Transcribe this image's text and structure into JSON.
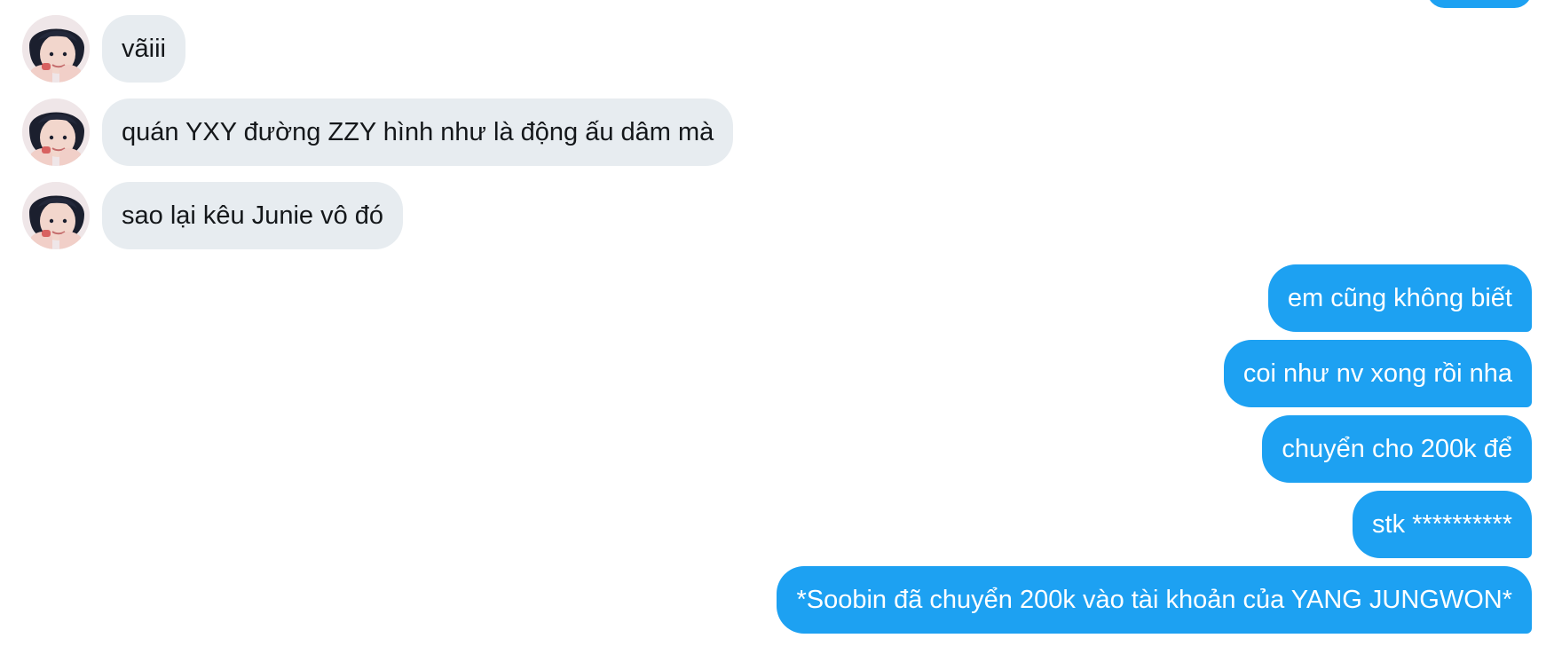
{
  "colors": {
    "incoming_bubble": "#e7ecf0",
    "outgoing_bubble": "#1da1f2",
    "incoming_text": "#14171a",
    "outgoing_text": "#ffffff"
  },
  "incoming": [
    {
      "text": "vãiii",
      "avatar": "avatar-icon"
    },
    {
      "text": "quán YXY đường ZZY hình như là động ấu dâm mà",
      "avatar": "avatar-icon"
    },
    {
      "text": "sao lại kêu Junie vô đó",
      "avatar": "avatar-icon"
    }
  ],
  "outgoing": [
    {
      "text": "em cũng không biết"
    },
    {
      "text": "coi như nv xong rồi nha"
    },
    {
      "text": "chuyển cho 200k để"
    },
    {
      "text": "stk **********"
    },
    {
      "text": "*Soobin đã chuyển 200k vào tài khoản của YANG JUNGWON*"
    }
  ]
}
